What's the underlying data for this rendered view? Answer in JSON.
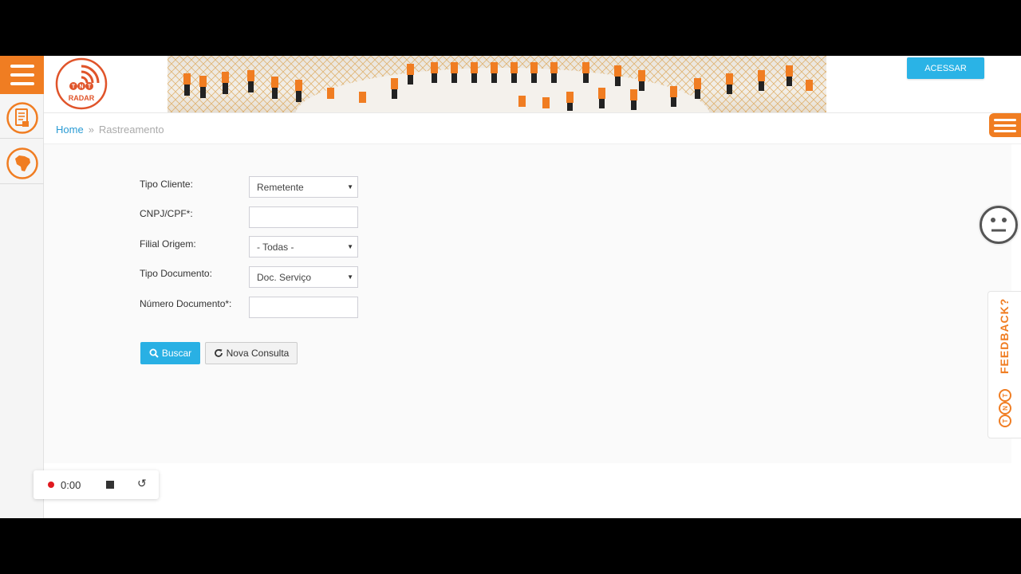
{
  "header": {
    "logo_text": "RADAR",
    "logo_brand": "TNT",
    "login_button": "ACESSAR"
  },
  "breadcrumb": {
    "home": "Home",
    "separator": "»",
    "current": "Rastreamento"
  },
  "form": {
    "tipo_cliente": {
      "label": "Tipo Cliente:",
      "value": "Remetente"
    },
    "cnpj_cpf": {
      "label": "CNPJ/CPF*:",
      "value": ""
    },
    "filial_origem": {
      "label": "Filial Origem:",
      "value": "- Todas -"
    },
    "tipo_documento": {
      "label": "Tipo Documento:",
      "value": "Doc. Serviço"
    },
    "numero_documento": {
      "label": "Número Documento*:",
      "value": ""
    }
  },
  "buttons": {
    "buscar": "Buscar",
    "nova_consulta": "Nova Consulta"
  },
  "feedback": {
    "label": "FEEDBACK?",
    "brand": "TNT"
  },
  "recorder": {
    "time": "0:00"
  },
  "colors": {
    "brand_orange": "#f07d22",
    "accent_blue": "#29b0e4",
    "link_blue": "#2a9bd4"
  },
  "icons": [
    "menu-icon",
    "document-icon",
    "brazil-map-icon",
    "search-icon",
    "refresh-icon",
    "neutral-face-icon",
    "stop-icon",
    "reset-icon"
  ]
}
